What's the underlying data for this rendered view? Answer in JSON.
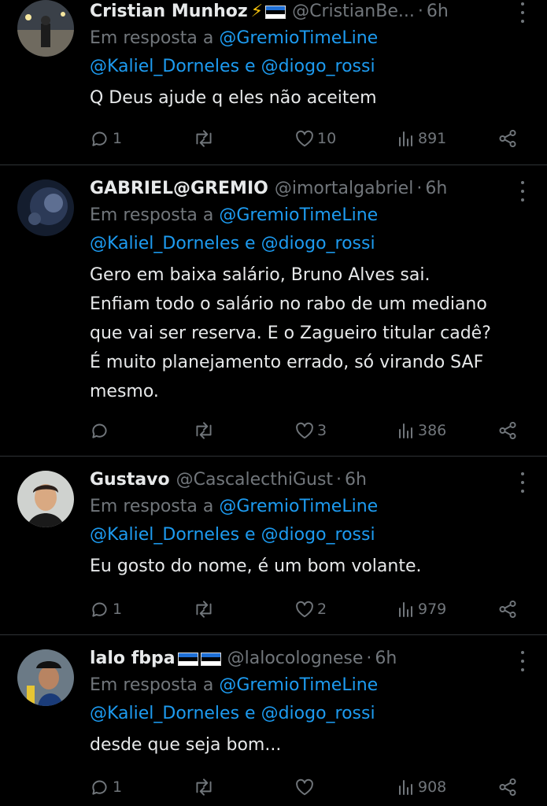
{
  "tweets": [
    {
      "name": "Cristian Munhoz",
      "badges": "⚡",
      "handle": "@CristianBe...",
      "dot": "·",
      "time": "6h",
      "reply_prefix": "Em resposta a ",
      "reply_to_1": "@GremioTimeLine",
      "reply_to_2": "@Kaliel_Dorneles",
      "reply_conj": " e ",
      "reply_to_3": "@diogo_rossi",
      "text": [
        "Q Deus ajude q eles não aceitem"
      ],
      "replies": "1",
      "retweets": "",
      "likes": "10",
      "views": "891"
    },
    {
      "name": "GABRIEL@GREMIO",
      "badges": "",
      "handle": "@imortalgabriel",
      "dot": "·",
      "time": "6h",
      "reply_prefix": "Em resposta a ",
      "reply_to_1": "@GremioTimeLine",
      "reply_to_2": "@Kaliel_Dorneles",
      "reply_conj": " e ",
      "reply_to_3": "@diogo_rossi",
      "text": [
        "Gero em baixa salário, Bruno Alves sai.",
        "Enfiam todo o salário no rabo de um mediano",
        "que vai ser reserva. E o Zagueiro titular cadê?",
        "É muito planejamento errado, só virando SAF",
        "mesmo."
      ],
      "replies": "",
      "retweets": "",
      "likes": "3",
      "views": "386"
    },
    {
      "name": "Gustavo",
      "badges": "",
      "handle": "@CascalecthiGust",
      "dot": "·",
      "time": "6h",
      "reply_prefix": "Em resposta a ",
      "reply_to_1": "@GremioTimeLine",
      "reply_to_2": "@Kaliel_Dorneles",
      "reply_conj": " e ",
      "reply_to_3": "@diogo_rossi",
      "text": [
        "Eu gosto do nome, é um bom volante."
      ],
      "replies": "1",
      "retweets": "",
      "likes": "2",
      "views": "979"
    },
    {
      "name": "lalo fbpa",
      "badges": "",
      "handle": "@lalocolognese",
      "dot": "·",
      "time": "6h",
      "reply_prefix": "Em resposta a ",
      "reply_to_1": "@GremioTimeLine",
      "reply_to_2": "@Kaliel_Dorneles",
      "reply_conj": " e ",
      "reply_to_3": "@diogo_rossi",
      "text": [
        "desde que seja bom..."
      ],
      "replies": "1",
      "retweets": "",
      "likes": "",
      "views": "908"
    }
  ],
  "icons": {
    "reply": "reply-icon",
    "retweet": "retweet-icon",
    "like": "like-icon",
    "views": "views-icon",
    "share": "share-icon",
    "more": "more-icon",
    "flag": "estonia-flag-icon"
  },
  "colors": {
    "background": "#000000",
    "text": "#e7e9ea",
    "muted": "#71767b",
    "link": "#1d9bf0",
    "divider": "#2f3336"
  }
}
